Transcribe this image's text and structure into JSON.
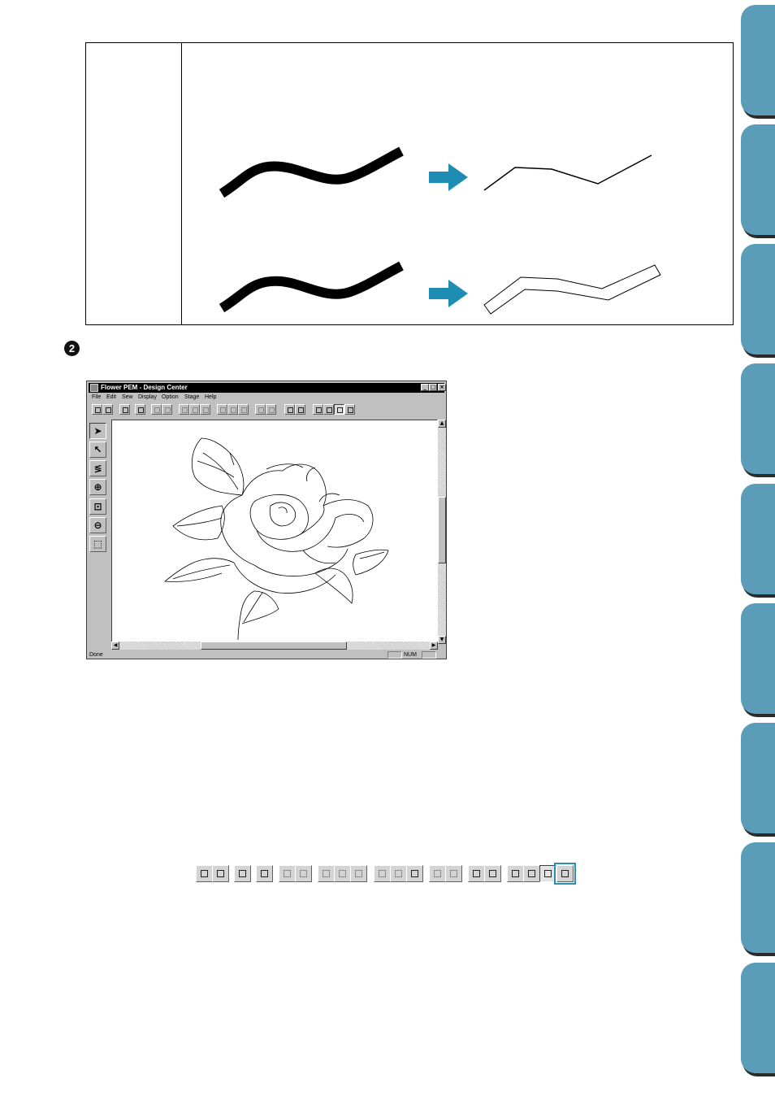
{
  "side_tabs": {
    "count": 9,
    "color": "#5b9db8"
  },
  "accent_color": "#1e8cb3",
  "step_marker": "2",
  "window": {
    "title": "Flower PEM - Design Center",
    "controls": [
      "_",
      "□",
      "×"
    ],
    "menu": [
      "File",
      "Edit",
      "Sew",
      "Display",
      "Option",
      "Stage",
      "Help"
    ],
    "left_tools": [
      "select-arrow-icon",
      "point-edit-icon",
      "stroke-icon",
      "zoom-in-icon",
      "zoom-fit-icon",
      "zoom-out-icon",
      "area-select-icon"
    ],
    "status": {
      "text": "Done",
      "num": "NUM"
    }
  },
  "toolbar_icons": [
    "new-icon",
    "open-icon",
    "import-icon",
    "save-icon",
    "undo-icon",
    "redo-icon",
    "cut-icon",
    "copy-icon",
    "paste-icon",
    "mirror-icon",
    "rotate-icon",
    "rotate-free-icon",
    "sew-setting-icon",
    "sew-setting-2-icon",
    "preview-icon",
    "realistic-preview-icon",
    "stage-1-icon",
    "stage-2-icon",
    "stage-3-icon",
    "stage-4-icon"
  ]
}
